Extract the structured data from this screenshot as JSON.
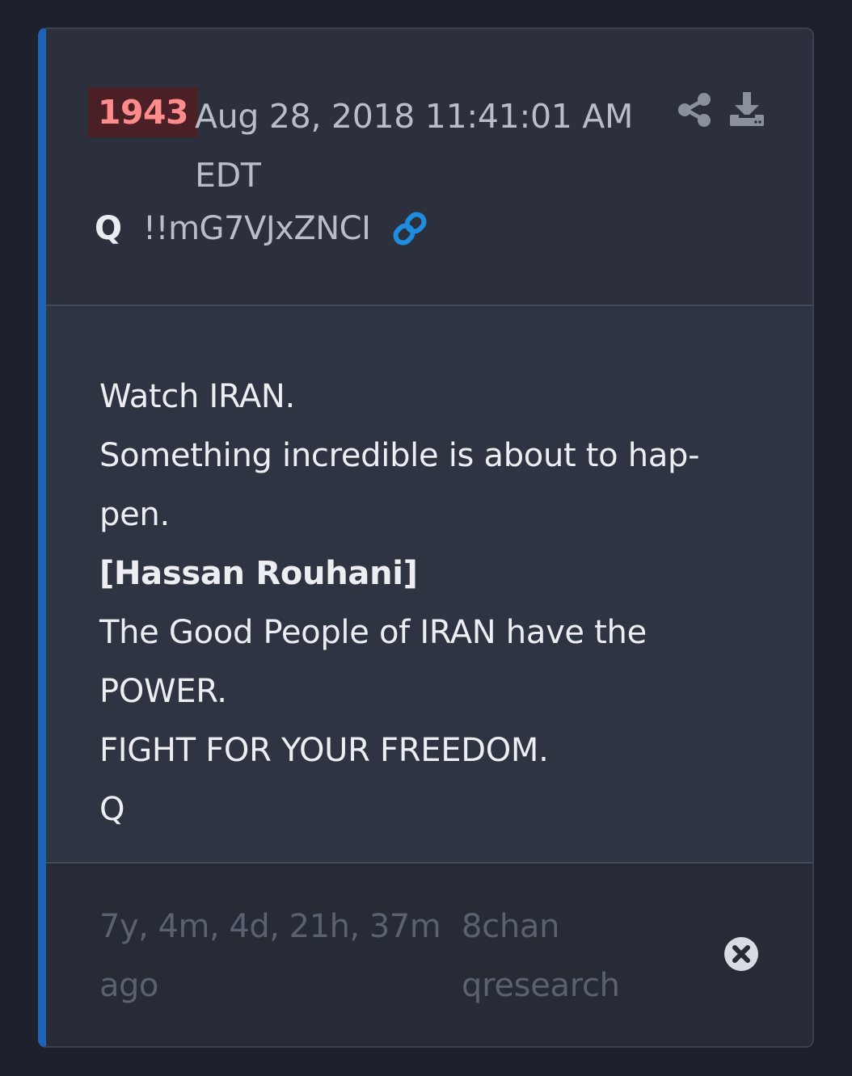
{
  "post": {
    "number": "1943",
    "timestamp": "Aug 28, 2018 11:41:01 AM EDT",
    "author": "Q",
    "tripcode": "!!mG7VJxZNCI",
    "body_lines": [
      "Watch IRAN.",
      "Something incredible is about to hap-",
      "pen.",
      "[Hassan Rouhani]",
      "The Good People of IRAN have the",
      "POWER.",
      "FIGHT FOR YOUR FREEDOM.",
      "Q"
    ],
    "age": "7y, 4m, 4d, 21h, 37m ago",
    "source": "8chan qresearch"
  },
  "icons": {
    "share": "share-icon",
    "download": "download-icon",
    "link": "link-icon",
    "close": "close-circle-icon"
  },
  "colors": {
    "accent_bar": "#1d64b8",
    "post_number": "#ff8c8c",
    "post_number_bg": "#4a1f25",
    "link": "#1e8de0"
  }
}
